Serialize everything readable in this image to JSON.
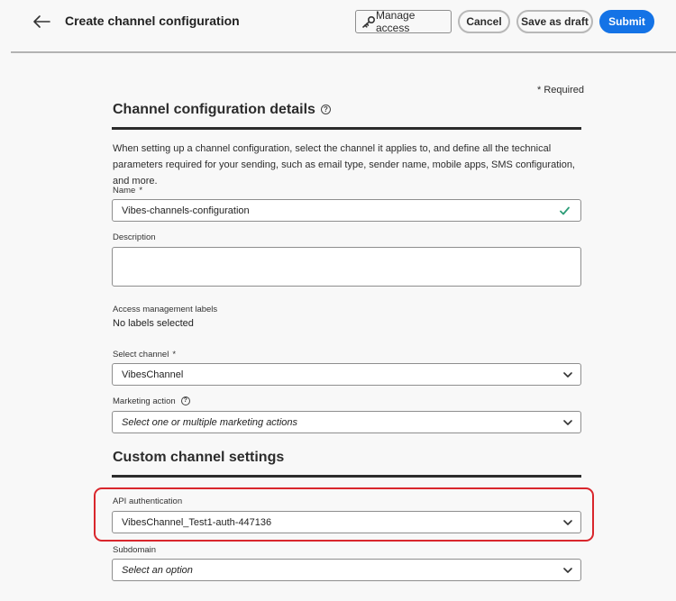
{
  "header": {
    "title": "Create channel configuration",
    "manage_access_label": "Manage access",
    "cancel_label": "Cancel",
    "save_draft_label": "Save as draft",
    "submit_label": "Submit"
  },
  "form": {
    "required_note": "* Required",
    "details_title": "Channel configuration details",
    "intro": "When setting up a channel configuration, select the channel it applies to, and define all the technical parameters required for your sending, such as email type, sender name, mobile apps, SMS configuration, and more.",
    "name": {
      "label": "Name",
      "required_mark": "*",
      "value": "Vibes-channels-configuration"
    },
    "description": {
      "label": "Description",
      "value": ""
    },
    "access_labels": {
      "label": "Access management labels",
      "value": "No labels selected"
    },
    "select_channel": {
      "label": "Select channel",
      "required_mark": "*",
      "value": "VibesChannel"
    },
    "marketing_action": {
      "label": "Marketing action",
      "placeholder": "Select one or multiple marketing actions"
    },
    "custom_title": "Custom channel settings",
    "api_auth": {
      "label": "API authentication",
      "value": "VibesChannel_Test1-auth-447136"
    },
    "subdomain": {
      "label": "Subdomain",
      "placeholder": "Select an option"
    }
  },
  "colors": {
    "accent": "#1473e6",
    "highlight": "#d9262c",
    "check": "#2d9d78"
  }
}
